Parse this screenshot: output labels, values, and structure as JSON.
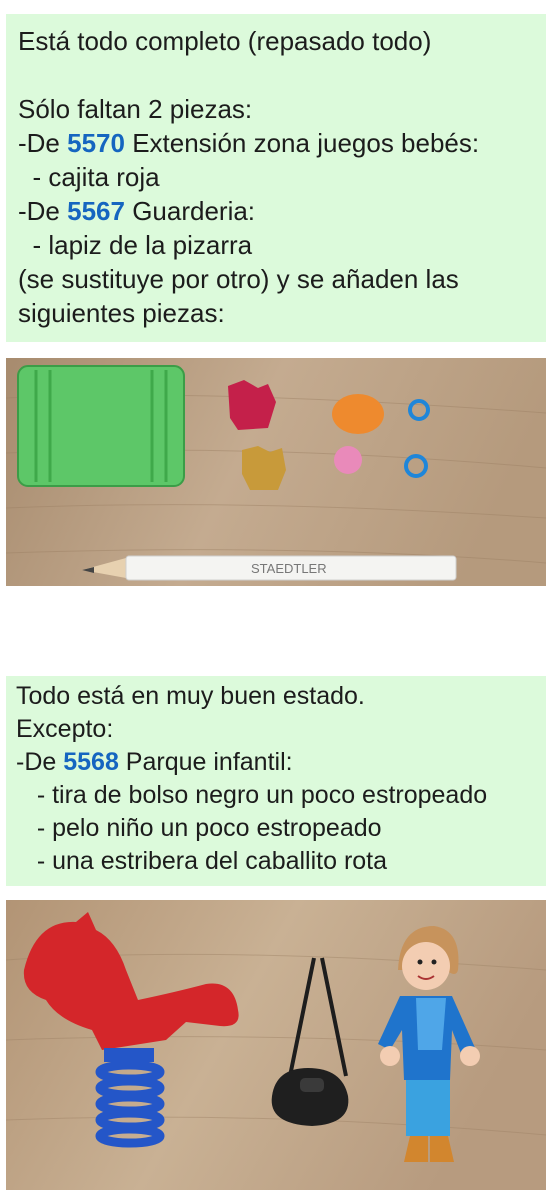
{
  "note1": {
    "line1": "Está todo completo (repasado todo)",
    "line2": "Sólo faltan 2 piezas:",
    "item1": {
      "prefix": "-De ",
      "code": "5570",
      "text": " Extensión zona juegos bebés:"
    },
    "sub1": "  - cajita roja",
    "item2": {
      "prefix": "-De ",
      "code": "5567",
      "text": " Guarderia:"
    },
    "sub2": "  - lapiz de la pizarra",
    "line3": "(se sustituye por otro) y se añaden las",
    "line4": "siguientes piezas:"
  },
  "photo1": {
    "pencil_brand": "STAEDTLER"
  },
  "note2": {
    "line1": "Todo está en muy buen estado.",
    "line2": "Excepto:",
    "item": {
      "prefix": "-De ",
      "code": "5568",
      "text": " Parque infantil:"
    },
    "sub1": "   - tira de bolso negro un poco estropeado",
    "sub2": "   - pelo niño un poco estropeado",
    "sub3": "   - una estribera del caballito rota"
  },
  "colors": {
    "note_background": "#dcfadb",
    "code_color": "#1565c0",
    "wood": "#b89c7e"
  }
}
